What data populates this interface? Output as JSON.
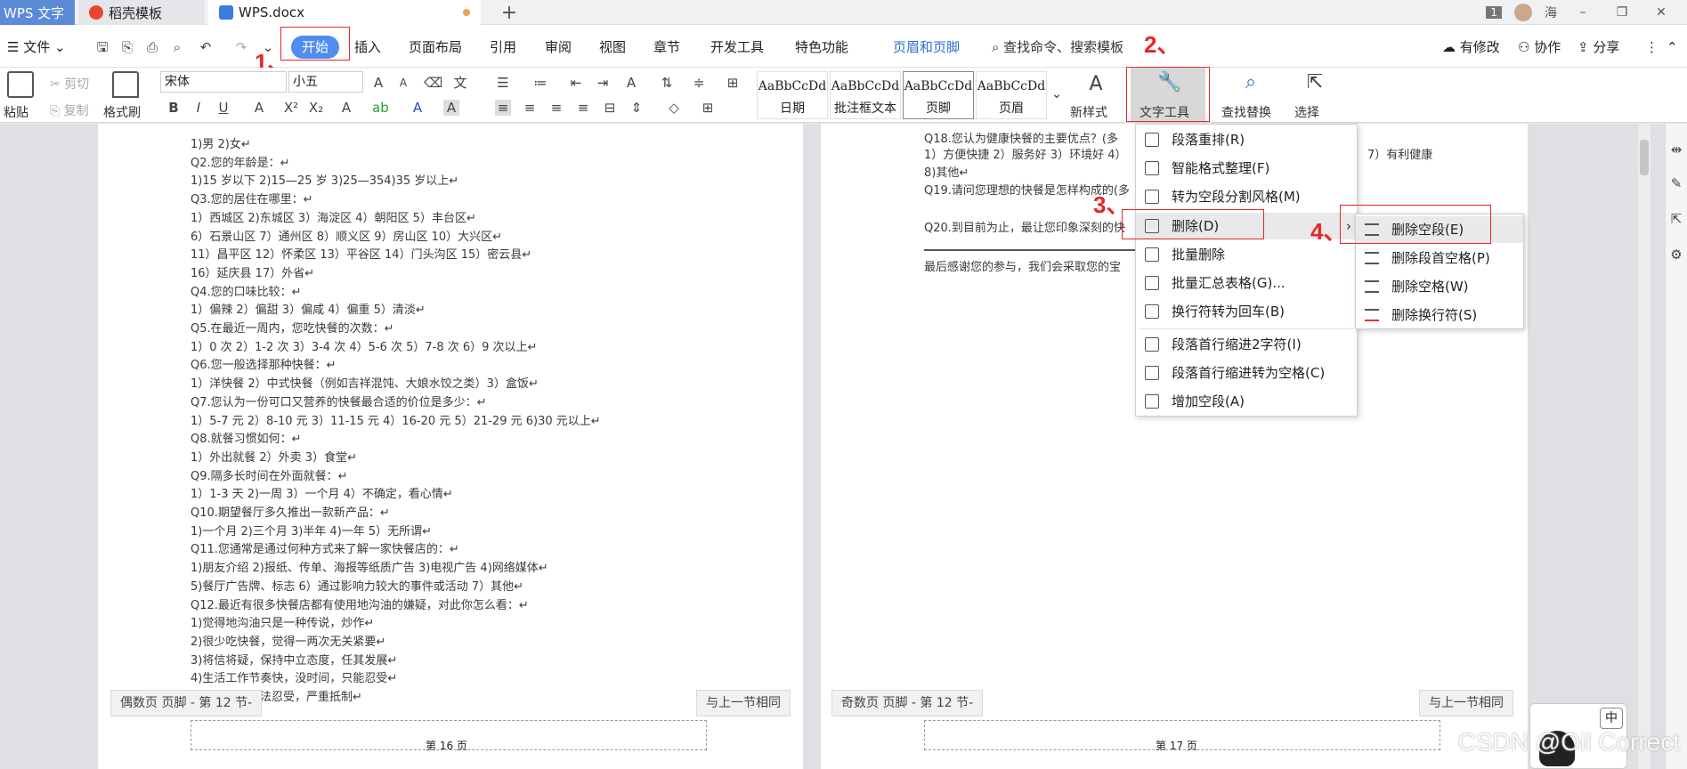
{
  "tabs": [
    {
      "label": "WPS 文字"
    },
    {
      "label": "稻壳模板"
    },
    {
      "label": "WPS.docx"
    }
  ],
  "titlebar": {
    "badge": "1",
    "user": "海"
  },
  "menu": {
    "file": "文件",
    "items": [
      "开始",
      "插入",
      "页面布局",
      "引用",
      "审阅",
      "视图",
      "章节",
      "开发工具",
      "特色功能",
      "页眉和页脚"
    ],
    "search": "查找命令、搜索模板",
    "right": [
      "有修改",
      "协作",
      "分享"
    ]
  },
  "toolbar": {
    "paste": "粘贴",
    "cut": "剪切",
    "copy": "复制",
    "format_painter": "格式刷",
    "font": "宋体",
    "size": "小五",
    "styles": [
      {
        "sample": "AaBbCcDd",
        "label": "日期"
      },
      {
        "sample": "AaBbCcDd",
        "label": "批注框文本"
      },
      {
        "sample": "AaBbCcDd",
        "label": "页脚"
      },
      {
        "sample": "AaBbCcDd",
        "label": "页眉"
      }
    ],
    "new_style": "新样式",
    "text_tools": "文字工具",
    "find_replace": "查找替换",
    "select": "选择"
  },
  "annotations": [
    "1、",
    "2、",
    "3、",
    "4、"
  ],
  "left_page": {
    "lines": [
      "1)男 2)女↵",
      "Q2.您的年龄是：↵",
      "1)15 岁以下 2)15—25 岁 3)25—354)35 岁以上↵",
      "Q3.您的居住在哪里：↵",
      "1）西城区 2)东城区 3）海淀区 4）朝阳区 5）丰台区↵",
      "6）石景山区 7）通州区 8）顺义区 9）房山区 10）大兴区↵",
      "11）昌平区 12）怀柔区 13）平谷区 14）门头沟区 15）密云县↵",
      "16）延庆县 17）外省↵",
      "Q4.您的口味比较：↵",
      "1）偏辣 2）偏甜 3）偏咸 4）偏重 5）清淡↵",
      "Q5.在最近一周内，您吃快餐的次数：↵",
      "1）0 次 2）1-2 次 3）3-4 次 4）5-6 次 5）7-8 次 6）9 次以上↵",
      "Q6.您一般选择那种快餐：↵",
      "1）洋快餐 2）中式快餐（例如吉祥混饨、大娘水饺之类）3）盒饭↵",
      "Q7.您认为一份可口又营养的快餐最合适的价位是多少：↵",
      "1）5-7 元 2）8-10 元 3）11-15 元 4）16-20 元 5）21-29 元 6)30 元以上↵",
      "Q8.就餐习惯如何：↵",
      "1）外出就餐 2）外卖 3）食堂↵",
      "Q9.隔多长时间在外面就餐：↵",
      "1）1-3 天 2)一周 3）一个月 4）不确定，看心情↵",
      "Q10.期望餐厅多久推出一款新产品：↵",
      "1)一个月 2)三个月 3)半年 4)一年 5）无所谓↵",
      "Q11.您通常是通过何种方式来了解一家快餐店的：↵",
      "1)朋友介绍 2)报纸、传单、海报等纸质广告 3)电视广告 4)网络媒体↵",
      "5)餐厅广告牌、标志 6）通过影响力较大的事件或活动 7）其他↵",
      "Q12.最近有很多快餐店都有使用地沟油的嫌疑，对此你怎么看：↵",
      "1)觉得地沟油只是一种传说，炒作↵",
      "2)很少吃快餐，觉得一两次无关紧要↵",
      "3)将信将疑，保持中立态度，任其发展↵",
      "4)生活工作节奏快，没时间，只能忍受↵",
      "油很恶心，无法忍受，严重抵制↵"
    ],
    "footer_label": "偶数页 页脚 - 第 12 节-",
    "same_as_prev": "与上一节相同",
    "page_no": "第 16 页"
  },
  "right_page": {
    "lines": [
      "Q18.您认为健康快餐的主要优点？(多",
      "1）方便快捷 2）服务好 3）环境好 4）",
      "8)其他↵",
      "Q19.请问您理想的快餐是怎样构成的(多",
      "Q20.到目前为止，最让您印象深刻的快",
      "最后感谢您的参与，我们会采取您的宝"
    ],
    "line_tail": "7）有利健康",
    "footer_label": "奇数页 页脚 - 第 12 节-",
    "same_as_prev": "与上一节相同",
    "page_no": "第 17 页"
  },
  "dropdown": {
    "items": [
      "段落重排(R)",
      "智能格式整理(F)",
      "转为空段分割风格(M)",
      "删除(D)",
      "批量删除",
      "批量汇总表格(G)...",
      "换行符转为回车(B)",
      "段落首行缩进2字符(I)",
      "段落首行缩进转为空格(C)",
      "增加空段(A)"
    ]
  },
  "submenu": {
    "items": [
      "删除空段(E)",
      "删除段首空格(P)",
      "删除空格(W)",
      "删除换行符(S)"
    ]
  },
  "ime": {
    "label": "中"
  },
  "watermark": "CSDN @Oil Correct",
  "colors": {
    "accent": "#4f8ef0",
    "annotation": "#e6262b",
    "wps_tab": "#5b8bd6"
  }
}
